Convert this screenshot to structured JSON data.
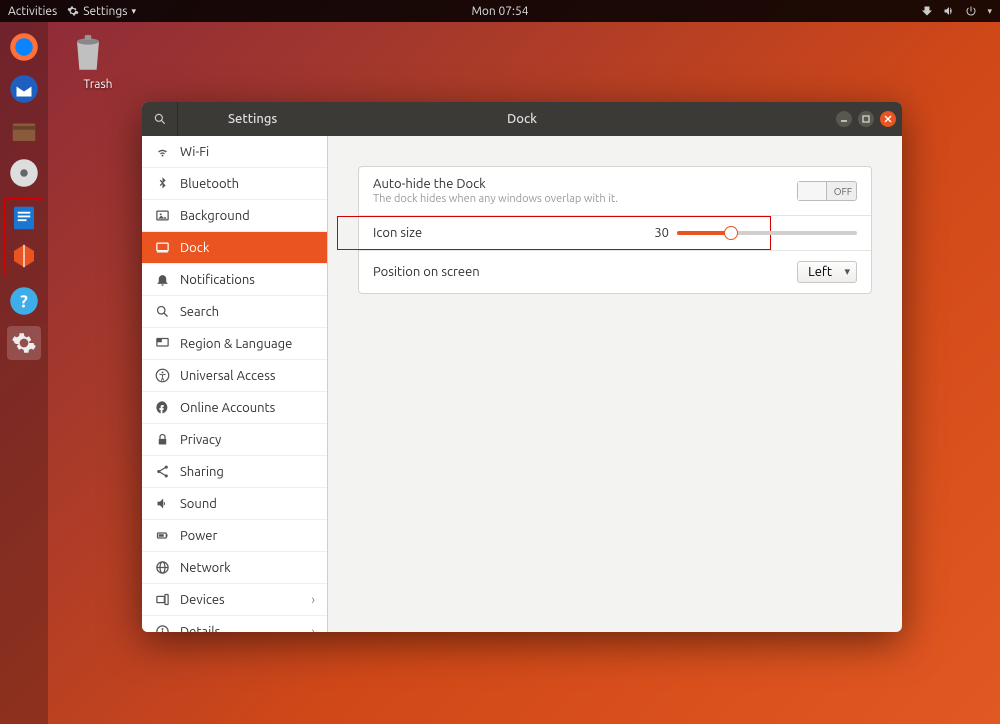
{
  "topbar": {
    "activities": "Activities",
    "app_menu": "Settings",
    "clock": "Mon 07:54"
  },
  "desktop": {
    "trash_label": "Trash"
  },
  "window": {
    "titlebar_left": "Settings",
    "titlebar_center": "Dock"
  },
  "sidebar": {
    "items": [
      {
        "label": "Wi-Fi",
        "icon": "wifi"
      },
      {
        "label": "Bluetooth",
        "icon": "bluetooth"
      },
      {
        "label": "Background",
        "icon": "background"
      },
      {
        "label": "Dock",
        "icon": "dock",
        "active": true
      },
      {
        "label": "Notifications",
        "icon": "bell"
      },
      {
        "label": "Search",
        "icon": "search"
      },
      {
        "label": "Region & Language",
        "icon": "region"
      },
      {
        "label": "Universal Access",
        "icon": "accessibility"
      },
      {
        "label": "Online Accounts",
        "icon": "online"
      },
      {
        "label": "Privacy",
        "icon": "privacy"
      },
      {
        "label": "Sharing",
        "icon": "sharing"
      },
      {
        "label": "Sound",
        "icon": "sound"
      },
      {
        "label": "Power",
        "icon": "power"
      },
      {
        "label": "Network",
        "icon": "network"
      },
      {
        "label": "Devices",
        "icon": "devices",
        "chevron": true
      },
      {
        "label": "Details",
        "icon": "details",
        "chevron": true
      }
    ]
  },
  "dock_settings": {
    "autohide_title": "Auto-hide the Dock",
    "autohide_sub": "The dock hides when any windows overlap with it.",
    "autohide_state": "OFF",
    "iconsize_label": "Icon size",
    "iconsize_value": "30",
    "position_label": "Position on screen",
    "position_value": "Left"
  }
}
